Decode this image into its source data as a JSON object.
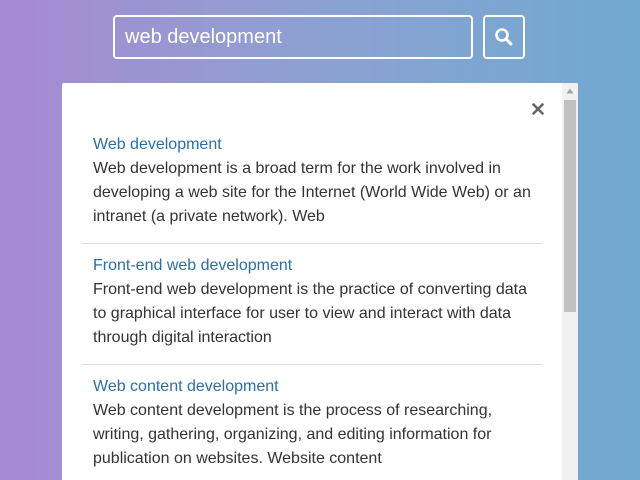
{
  "search": {
    "value": "web development",
    "button_icon": "search-icon"
  },
  "panel": {
    "close_icon": "close-icon",
    "results": [
      {
        "title": "Web development",
        "snippet": "Web development is a broad term for the work involved in developing a web site for the Internet (World Wide Web) or an intranet (a private network). Web"
      },
      {
        "title": "Front-end web development",
        "snippet": "Front-end web development is the practice of converting data to graphical interface for user to view and interact with data through digital interaction"
      },
      {
        "title": "Web content development",
        "snippet": "Web content development is the process of researching, writing, gathering, organizing, and editing information for publication on websites. Website content"
      }
    ]
  },
  "colors": {
    "background_start": "#a78ad2",
    "background_end": "#70a9d0",
    "link": "#2a6fa8",
    "text": "#333333"
  }
}
